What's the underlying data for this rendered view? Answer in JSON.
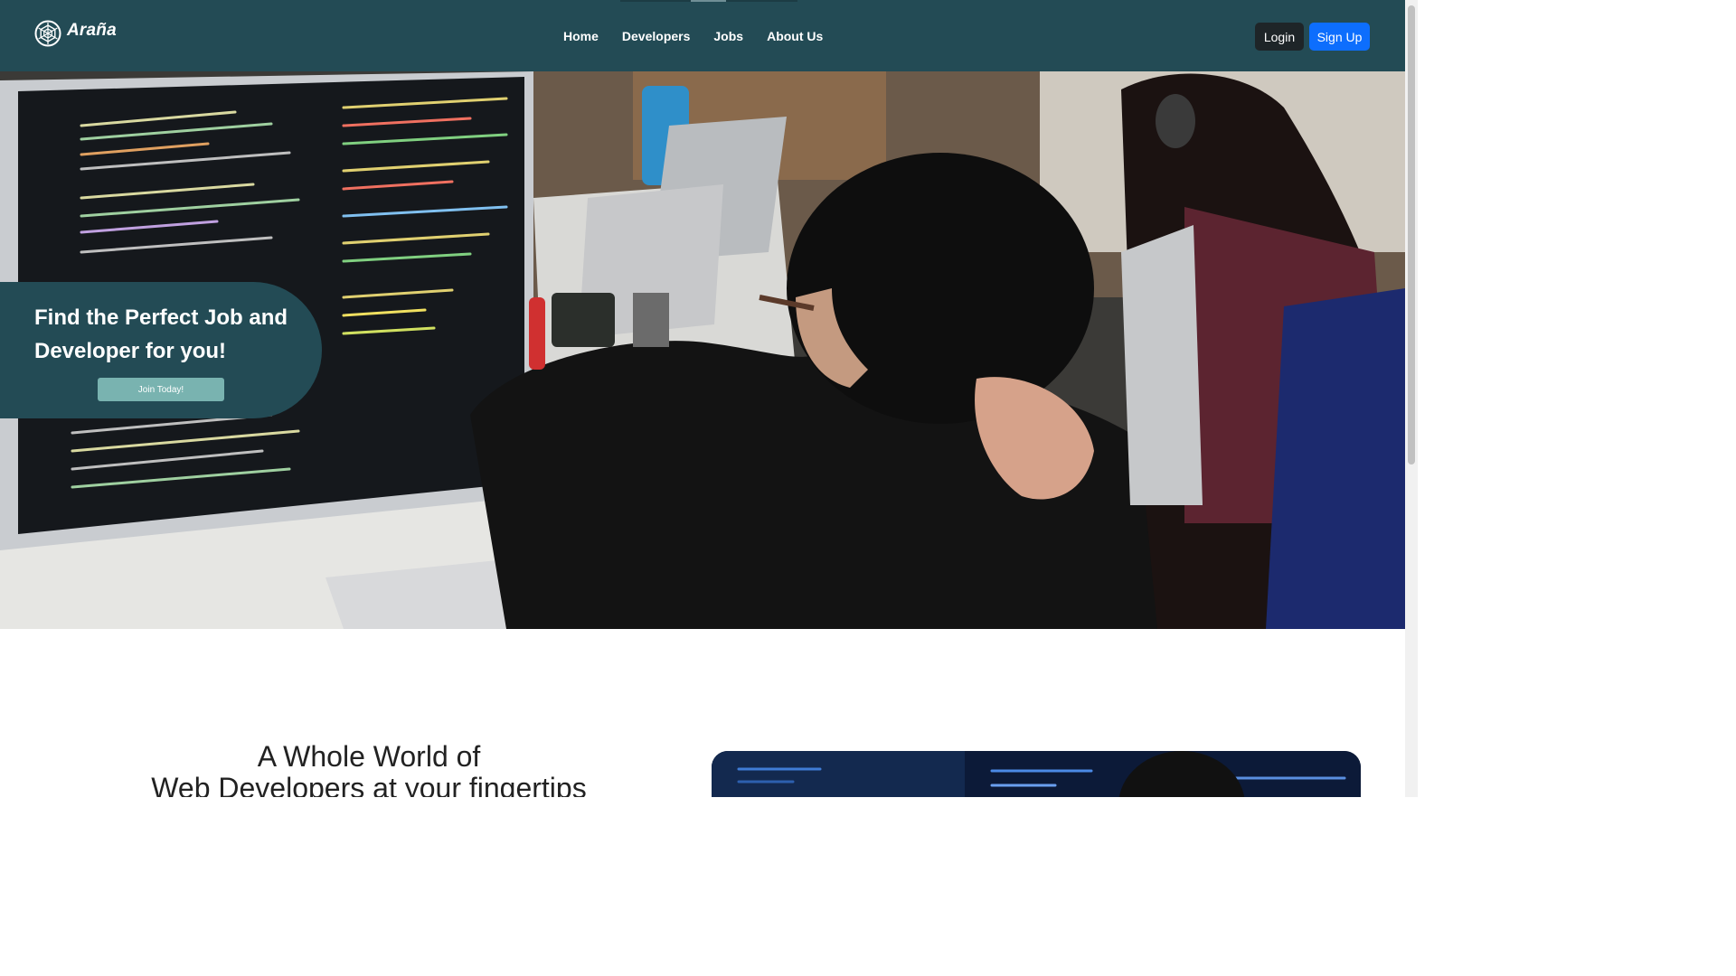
{
  "brand": {
    "name": "Araña",
    "logo_icon": "spider-web-icon"
  },
  "nav": {
    "links": [
      {
        "label": "Home"
      },
      {
        "label": "Developers"
      },
      {
        "label": "Jobs"
      },
      {
        "label": "About Us"
      }
    ],
    "login_label": "Login",
    "signup_label": "Sign Up"
  },
  "hero": {
    "title": "Find the Perfect Job and Developer for you!",
    "cta_label": "Join Today!",
    "image_subject": "developers working at computers in an office"
  },
  "section": {
    "title_line1": "A Whole World of",
    "title_line2": "Web Developers at your fingertips",
    "image_subject": "developer at a screen of code"
  },
  "colors": {
    "navbar": "#234b55",
    "signup_button": "#0d6efd",
    "login_button": "#1e2528",
    "cta_button": "#79b3b0"
  }
}
